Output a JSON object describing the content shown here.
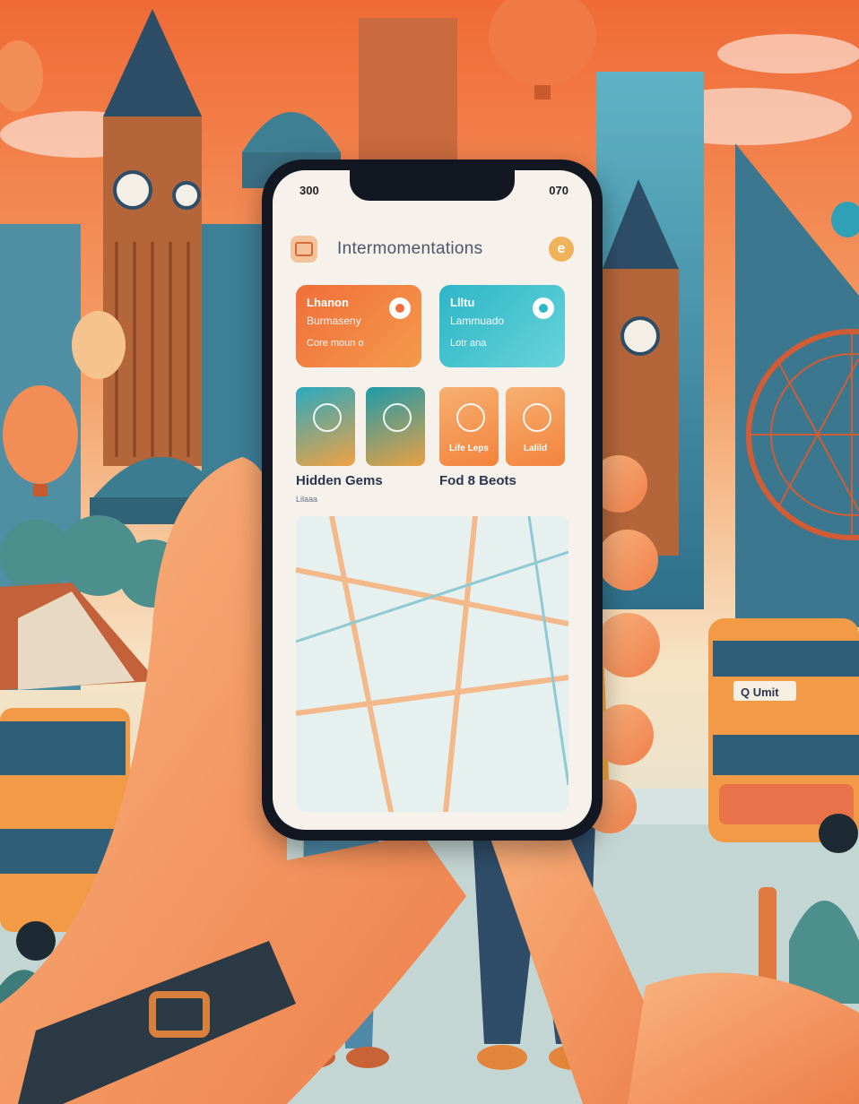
{
  "phone": {
    "status_time": "300",
    "status_right": "070"
  },
  "app": {
    "title": "Intermomentations",
    "profile_letter": "e"
  },
  "cards": [
    {
      "line1": "Lhanon",
      "line2": "Burmaseny",
      "line3": "Core moun o"
    },
    {
      "line1": "Llltu",
      "line2": "Lammuado",
      "line3": "Lotr ana"
    }
  ],
  "tiles": [
    {
      "label": ""
    },
    {
      "label": ""
    },
    {
      "label": "Life Leps"
    },
    {
      "label": "Lalild"
    }
  ],
  "sections": {
    "left": "Hidden Gems",
    "left_sub": "Lilaaa",
    "right": "Fod 8 Beots"
  },
  "bus": {
    "plate": "Q Umit"
  },
  "colors": {
    "sky_top": "#f06a36",
    "sky_mid": "#f5a26a",
    "accent_orange": "#f06f3c",
    "accent_teal": "#2eb6c7"
  },
  "icons": [
    "clock-icon",
    "heart-icon",
    "eye-icon",
    "map-icon"
  ]
}
